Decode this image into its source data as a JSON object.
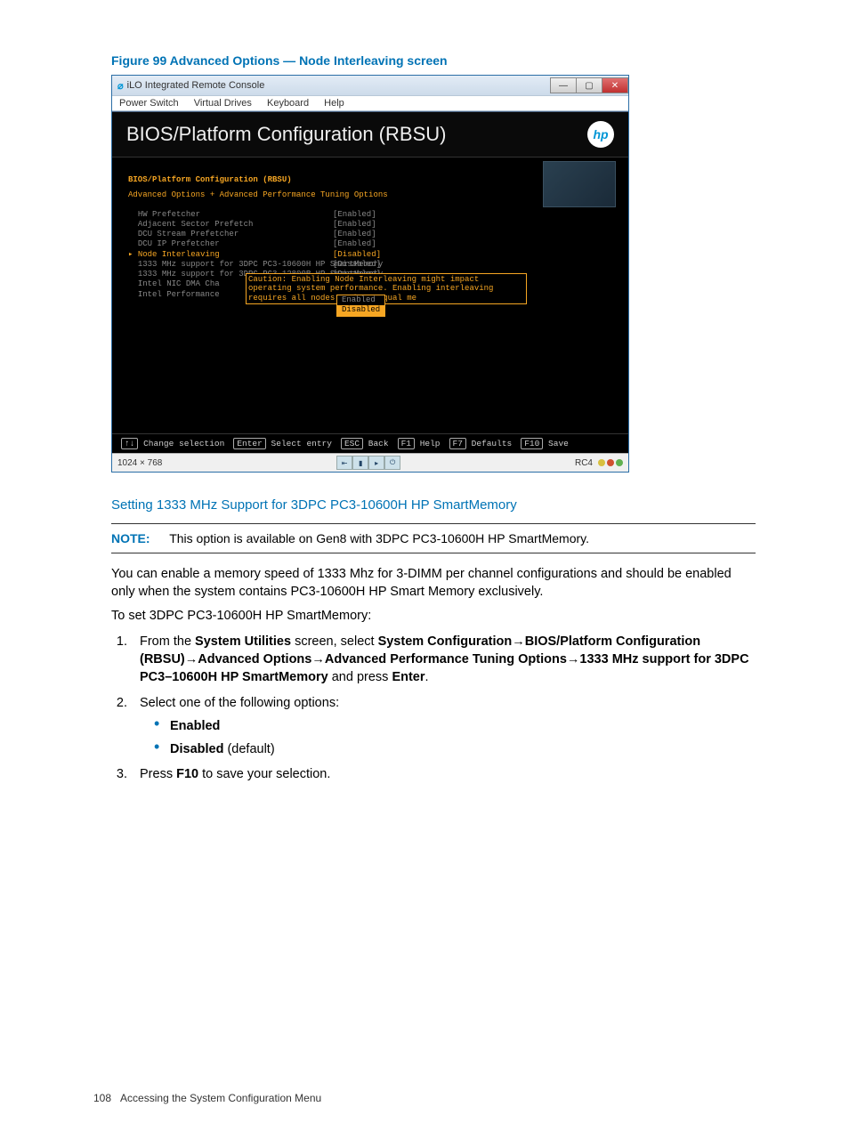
{
  "figure_caption": "Figure 99 Advanced Options — Node Interleaving screen",
  "window": {
    "title": "iLO Integrated Remote Console",
    "menu": [
      "Power Switch",
      "Virtual Drives",
      "Keyboard",
      "Help"
    ]
  },
  "bios": {
    "header_title": "BIOS/Platform Configuration (RBSU)",
    "breadcrumb1": "BIOS/Platform Configuration (RBSU)",
    "breadcrumb2": "Advanced Options + Advanced Performance Tuning Options",
    "options": [
      {
        "name": "HW Prefetcher",
        "value": "[Enabled]"
      },
      {
        "name": "Adjacent Sector Prefetch",
        "value": "[Enabled]"
      },
      {
        "name": "DCU Stream Prefetcher",
        "value": "[Enabled]"
      },
      {
        "name": "DCU IP Prefetcher",
        "value": "[Enabled]"
      },
      {
        "name": "Node Interleaving",
        "value": "[Disabled]",
        "selected": true
      },
      {
        "name": "1333 MHz support for 3DPC PC3-10600H HP SmartMemory",
        "value": "[Disabled]"
      },
      {
        "name": "1333 MHz support for 3DPC PC3-12800R HP SmartMemory",
        "value": "[Disabled]"
      },
      {
        "name": "Intel NIC DMA Cha",
        "value": ""
      },
      {
        "name": "Intel Performance",
        "value": ""
      }
    ],
    "caution": "Caution: Enabling Node Interleaving might impact operating system performance. Enabling interleaving requires all nodes to have equal me",
    "dropdown": {
      "opt1": "Enabled",
      "opt2": "Disabled"
    },
    "keys": {
      "updown_label": "Change selection",
      "enter_label": "Select entry",
      "esc_label": "Back",
      "f1_label": "Help",
      "f7_label": "Defaults",
      "f10_label": "Save"
    },
    "statusbar": {
      "res": "1024 × 768",
      "rc": "RC4"
    }
  },
  "section_title": "Setting 1333 MHz Support for 3DPC PC3-10600H HP SmartMemory",
  "note": {
    "label": "NOTE:",
    "text": "This option is available on Gen8 with 3DPC PC3-10600H HP SmartMemory."
  },
  "para1": "You can enable a memory speed of 1333 Mhz for 3-DIMM per channel configurations and should be enabled only when the system contains PC3-10600H HP Smart Memory exclusively.",
  "para2": "To set 3DPC PC3-10600H HP SmartMemory:",
  "steps": {
    "s1_a": "From the ",
    "s1_b": "System Utilities",
    "s1_c": " screen, select ",
    "s1_d": "System Configuration",
    "s1_e": "BIOS/Platform Configuration (RBSU)",
    "s1_f": "Advanced Options",
    "s1_g": "Advanced Performance Tuning Options",
    "s1_h": "1333 MHz support for 3DPC PC3–10600H HP SmartMemory",
    "s1_i": " and press ",
    "s1_j": "Enter",
    "s2": "Select one of the following options:",
    "opt1": "Enabled",
    "opt2a": "Disabled",
    "opt2b": " (default)",
    "s3a": "Press ",
    "s3b": "F10",
    "s3c": " to save your selection."
  },
  "footer": {
    "pageno": "108",
    "text": "Accessing the System Configuration Menu"
  }
}
